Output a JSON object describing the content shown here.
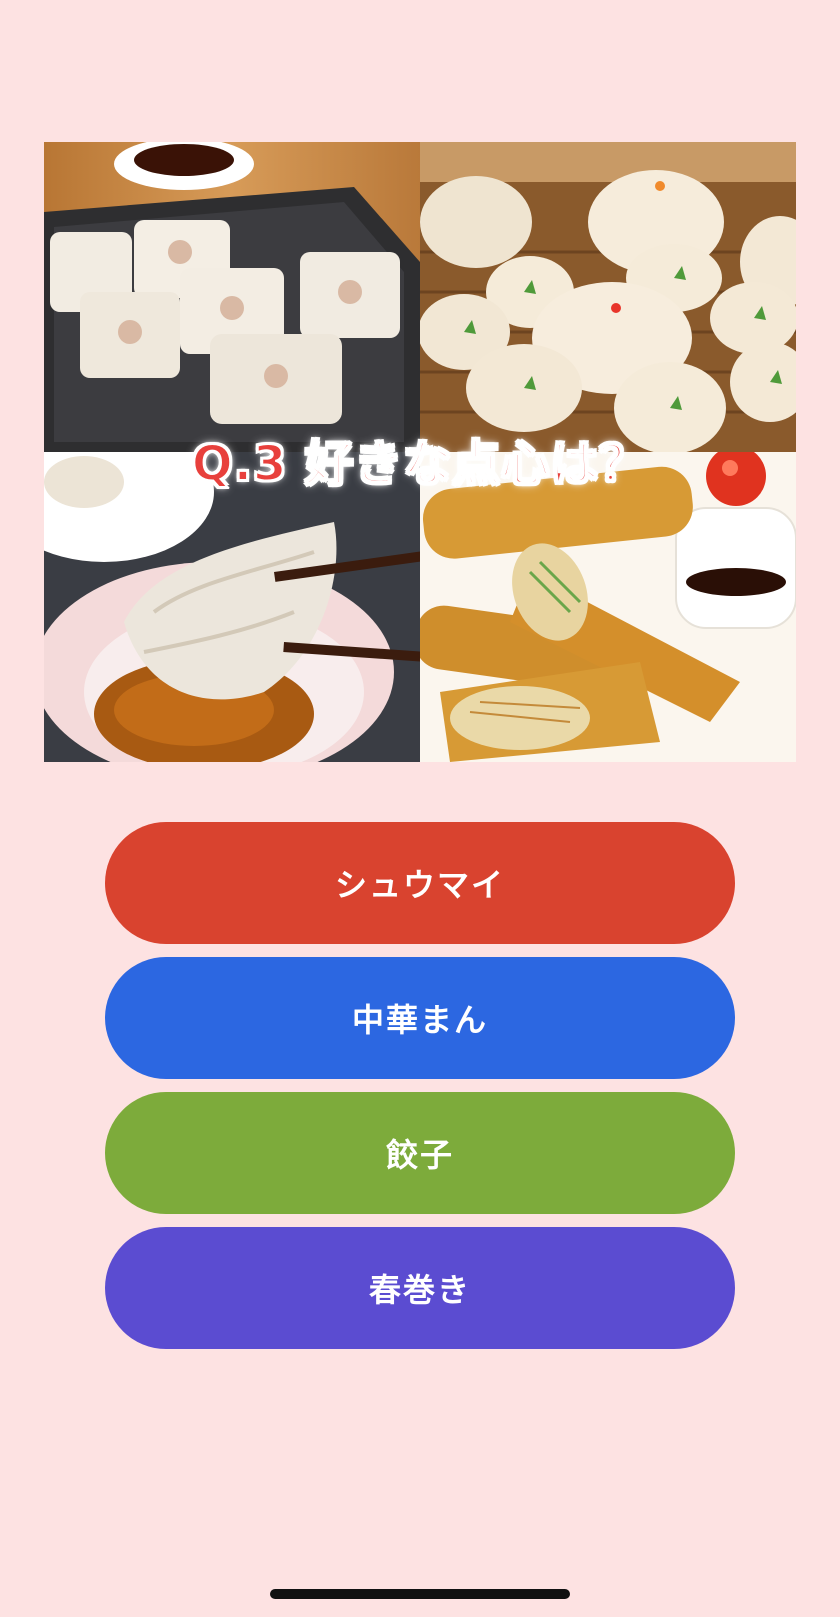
{
  "question": {
    "title": "Q.3 好きな点心は？"
  },
  "photos": [
    {
      "icon": "shumai-photo"
    },
    {
      "icon": "chukaman-photo"
    },
    {
      "icon": "gyoza-photo"
    },
    {
      "icon": "harumaki-photo"
    }
  ],
  "answers": [
    {
      "label": "シュウマイ",
      "color": "#d9432f"
    },
    {
      "label": "中華まん",
      "color": "#2c67e1"
    },
    {
      "label": "餃子",
      "color": "#7dab3b"
    },
    {
      "label": "春巻き",
      "color": "#5b4cd1"
    }
  ],
  "colors": {
    "background": "#fde2e2",
    "title_text": "#e8403c"
  }
}
